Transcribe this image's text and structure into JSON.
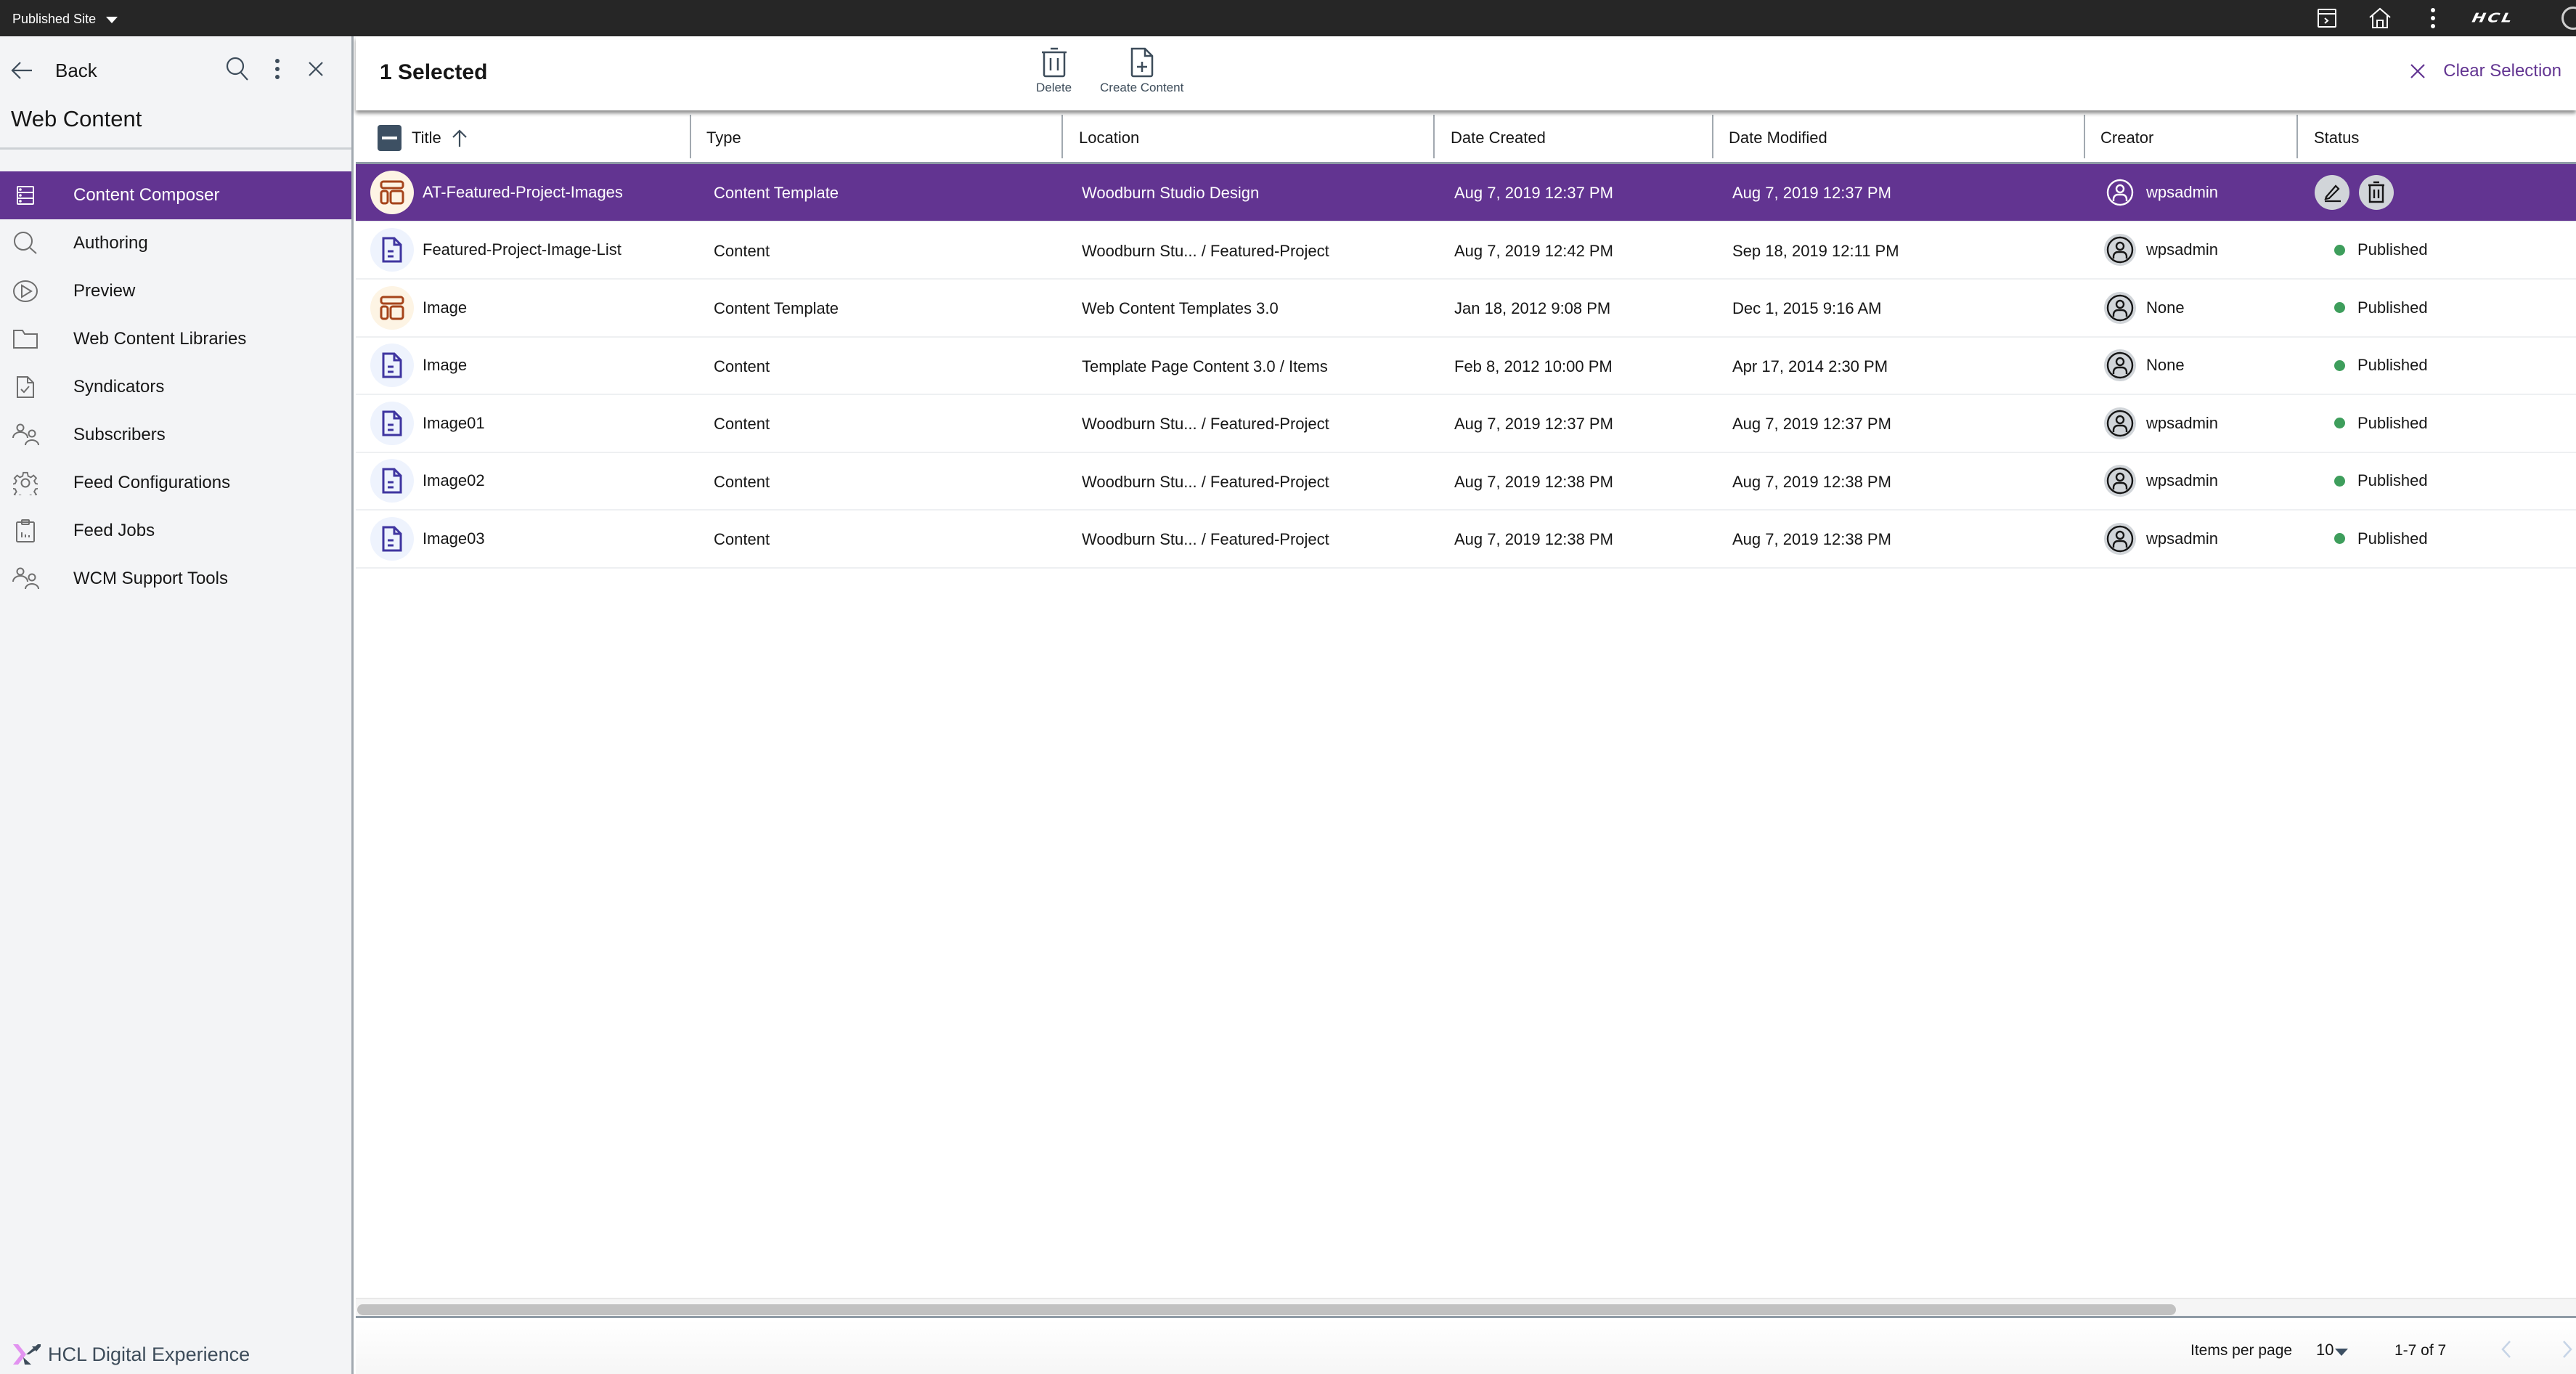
{
  "topbar": {
    "site_selector": "Published Site",
    "brand_logo": "HCL",
    "icons": [
      "terminal-window-icon",
      "home-icon",
      "overflow-menu-icon"
    ]
  },
  "sidebar": {
    "back_label": "Back",
    "title": "Web Content",
    "items": [
      {
        "label": "Content Composer",
        "icon": "content-composer-icon",
        "active": true
      },
      {
        "label": "Authoring",
        "icon": "search-icon",
        "active": false
      },
      {
        "label": "Preview",
        "icon": "play-circle-icon",
        "active": false
      },
      {
        "label": "Web Content Libraries",
        "icon": "folder-icon",
        "active": false
      },
      {
        "label": "Syndicators",
        "icon": "document-check-icon",
        "active": false
      },
      {
        "label": "Subscribers",
        "icon": "users-icon",
        "active": false
      },
      {
        "label": "Feed Configurations",
        "icon": "gear-icon",
        "active": false
      },
      {
        "label": "Feed Jobs",
        "icon": "clipboard-chart-icon",
        "active": false
      },
      {
        "label": "WCM Support Tools",
        "icon": "users-icon",
        "active": false
      }
    ],
    "footer_brand": "HCL Digital Experience"
  },
  "selection_bar": {
    "count_label": "1 Selected",
    "delete_label": "Delete",
    "create_label": "Create Content",
    "clear_label": "Clear Selection"
  },
  "table": {
    "columns": [
      "Title",
      "Type",
      "Location",
      "Date Created",
      "Date Modified",
      "Creator",
      "Status"
    ],
    "sort": {
      "column": "Title",
      "direction": "ascending"
    },
    "rows": [
      {
        "title": "AT-Featured-Project-Images",
        "kind": "template",
        "type": "Content Template",
        "location": "Woodburn Studio Design",
        "created": "Aug 7, 2019 12:37 PM",
        "modified": "Aug 7, 2019 12:37 PM",
        "creator": "wpsadmin",
        "status": "",
        "selected": true
      },
      {
        "title": "Featured-Project-Image-List",
        "kind": "content",
        "type": "Content",
        "location": "Woodburn Stu... / Featured-Project",
        "created": "Aug 7, 2019 12:42 PM",
        "modified": "Sep 18, 2019 12:11 PM",
        "creator": "wpsadmin",
        "status": "Published",
        "selected": false
      },
      {
        "title": "Image",
        "kind": "template",
        "type": "Content Template",
        "location": "Web Content Templates 3.0",
        "created": "Jan 18, 2012 9:08 PM",
        "modified": "Dec 1, 2015 9:16 AM",
        "creator": "None",
        "status": "Published",
        "selected": false
      },
      {
        "title": "Image",
        "kind": "content",
        "type": "Content",
        "location": "Template Page Content 3.0 / Items",
        "created": "Feb 8, 2012 10:00 PM",
        "modified": "Apr 17, 2014 2:30 PM",
        "creator": "None",
        "status": "Published",
        "selected": false
      },
      {
        "title": "Image01",
        "kind": "content",
        "type": "Content",
        "location": "Woodburn Stu... / Featured-Project",
        "created": "Aug 7, 2019 12:37 PM",
        "modified": "Aug 7, 2019 12:37 PM",
        "creator": "wpsadmin",
        "status": "Published",
        "selected": false
      },
      {
        "title": "Image02",
        "kind": "content",
        "type": "Content",
        "location": "Woodburn Stu... / Featured-Project",
        "created": "Aug 7, 2019 12:38 PM",
        "modified": "Aug 7, 2019 12:38 PM",
        "creator": "wpsadmin",
        "status": "Published",
        "selected": false
      },
      {
        "title": "Image03",
        "kind": "content",
        "type": "Content",
        "location": "Woodburn Stu... / Featured-Project",
        "created": "Aug 7, 2019 12:38 PM",
        "modified": "Aug 7, 2019 12:38 PM",
        "creator": "wpsadmin",
        "status": "Published",
        "selected": false
      }
    ],
    "selected_row_actions": [
      "edit",
      "delete"
    ]
  },
  "pagination": {
    "items_per_page_label": "Items per page",
    "items_per_page": "10",
    "range_label": "1-7 of 7"
  },
  "colors": {
    "accent": "#623491",
    "topbar": "#262626",
    "sidebar_bg": "#f3f4f6",
    "published": "#3e9e5c",
    "template_icon": "#a5441a",
    "content_icon": "#3f35a0"
  }
}
